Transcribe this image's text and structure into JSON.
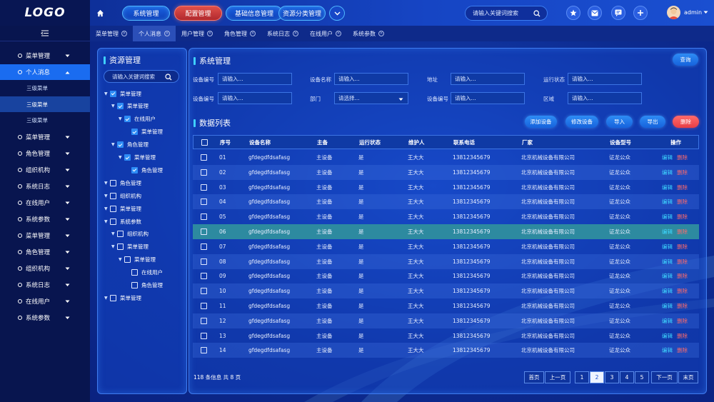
{
  "app": {
    "logo": "LOGO"
  },
  "topnav": [
    {
      "label": "系统管理",
      "active": false
    },
    {
      "label": "配置管理",
      "active": true
    },
    {
      "label": "基础信息管理",
      "active": false
    },
    {
      "label": "资源分类管理",
      "active": false
    }
  ],
  "top_search": {
    "placeholder": "请输入关键词搜索"
  },
  "user": {
    "name": "admin"
  },
  "sidebar": {
    "items": [
      {
        "label": "菜单管理",
        "active": false
      },
      {
        "label": "个人消息",
        "active": true,
        "expanded": true,
        "children": [
          {
            "label": "三级菜单",
            "active": false
          },
          {
            "label": "三级菜单",
            "active": true
          },
          {
            "label": "三级菜单",
            "active": false
          }
        ]
      },
      {
        "label": "菜单管理",
        "active": false
      },
      {
        "label": "角色管理",
        "active": false
      },
      {
        "label": "组织机构",
        "active": false
      },
      {
        "label": "系统日志",
        "active": false
      },
      {
        "label": "在线用户",
        "active": false
      },
      {
        "label": "系统参数",
        "active": false
      },
      {
        "label": "菜单管理",
        "active": false
      },
      {
        "label": "角色管理",
        "active": false
      },
      {
        "label": "组织机构",
        "active": false
      },
      {
        "label": "系统日志",
        "active": false
      },
      {
        "label": "在线用户",
        "active": false
      },
      {
        "label": "系统参数",
        "active": false
      }
    ]
  },
  "tabs": [
    {
      "label": "菜单管理",
      "active": false
    },
    {
      "label": "个人消息",
      "active": true
    },
    {
      "label": "用户管理",
      "active": false
    },
    {
      "label": "角色管理",
      "active": false
    },
    {
      "label": "系统日志",
      "active": false
    },
    {
      "label": "在线用户",
      "active": false
    },
    {
      "label": "系统参数",
      "active": false
    }
  ],
  "tree": {
    "title": "资源管理",
    "search_placeholder": "请输入关键词搜索",
    "nodes": [
      {
        "label": "菜单管理",
        "level": 0,
        "caret": true,
        "checked": true
      },
      {
        "label": "菜单管理",
        "level": 1,
        "caret": true,
        "checked": true
      },
      {
        "label": "在线用户",
        "level": 2,
        "caret": true,
        "checked": true
      },
      {
        "label": "菜单管理",
        "level": 3,
        "caret": false,
        "checked": true
      },
      {
        "label": "角色管理",
        "level": 1,
        "caret": true,
        "checked": true
      },
      {
        "label": "菜单管理",
        "level": 2,
        "caret": true,
        "checked": true
      },
      {
        "label": "角色管理",
        "level": 3,
        "caret": false,
        "checked": true
      },
      {
        "label": "角色管理",
        "level": 0,
        "caret": true,
        "checked": false
      },
      {
        "label": "组织机构",
        "level": 0,
        "caret": true,
        "checked": false
      },
      {
        "label": "菜单管理",
        "level": 0,
        "caret": true,
        "checked": false
      },
      {
        "label": "系统参数",
        "level": 0,
        "caret": true,
        "checked": false
      },
      {
        "label": "组织机构",
        "level": 1,
        "caret": true,
        "checked": false
      },
      {
        "label": "菜单管理",
        "level": 1,
        "caret": true,
        "checked": false
      },
      {
        "label": "菜单管理",
        "level": 2,
        "caret": true,
        "checked": false
      },
      {
        "label": "在线用户",
        "level": 3,
        "caret": false,
        "checked": false
      },
      {
        "label": "角色管理",
        "level": 3,
        "caret": false,
        "checked": false
      },
      {
        "label": "菜单管理",
        "level": 0,
        "caret": true,
        "checked": false
      }
    ]
  },
  "system": {
    "title": "系统管理",
    "query_label": "查询"
  },
  "filters": [
    {
      "label": "设备编号",
      "value": "请输入...",
      "select": false
    },
    {
      "label": "设备名称",
      "value": "请输入...",
      "select": false
    },
    {
      "label": "地址",
      "value": "请输入...",
      "select": false
    },
    {
      "label": "运行状态",
      "value": "请输入...",
      "select": false
    },
    {
      "label": "设备编号",
      "value": "请输入...",
      "select": false
    },
    {
      "label": "部门",
      "value": "请选择...",
      "select": true
    },
    {
      "label": "设备编号",
      "value": "请输入...",
      "select": false
    },
    {
      "label": "区域",
      "value": "请输入...",
      "select": false
    }
  ],
  "data_list": {
    "title": "数据列表",
    "actions": [
      {
        "label": "添加设备",
        "danger": false
      },
      {
        "label": "修改设备",
        "danger": false
      },
      {
        "label": "导入",
        "danger": false
      },
      {
        "label": "导出",
        "danger": false
      },
      {
        "label": "删除",
        "danger": true
      }
    ]
  },
  "table": {
    "columns": [
      "序号",
      "设备名称",
      "主备",
      "运行状态",
      "维护人",
      "联系电话",
      "厂家",
      "设备型号",
      "操作"
    ],
    "edit_label": "编辑",
    "delete_label": "删除",
    "selected_row": 5,
    "rows": [
      [
        "01",
        "gfdegdfdsafasg",
        "主设备",
        "是",
        "王大大",
        "13812345679",
        "北京机械设备有限公司",
        "证龙公众"
      ],
      [
        "02",
        "gfdegdfdsafasg",
        "主设备",
        "是",
        "王大大",
        "13812345679",
        "北京机械设备有限公司",
        "证龙公众"
      ],
      [
        "03",
        "gfdegdfdsafasg",
        "主设备",
        "是",
        "王大大",
        "13812345679",
        "北京机械设备有限公司",
        "证龙公众"
      ],
      [
        "04",
        "gfdegdfdsafasg",
        "主设备",
        "是",
        "王大大",
        "13812345679",
        "北京机械设备有限公司",
        "证龙公众"
      ],
      [
        "05",
        "gfdegdfdsafasg",
        "主设备",
        "是",
        "王大大",
        "13812345679",
        "北京机械设备有限公司",
        "证龙公众"
      ],
      [
        "06",
        "gfdegdfdsafasg",
        "主设备",
        "是",
        "王大大",
        "13812345679",
        "北京机械设备有限公司",
        "证龙公众"
      ],
      [
        "07",
        "gfdegdfdsafasg",
        "主设备",
        "是",
        "王大大",
        "13812345679",
        "北京机械设备有限公司",
        "证龙公众"
      ],
      [
        "08",
        "gfdegdfdsafasg",
        "主设备",
        "是",
        "王大大",
        "13812345679",
        "北京机械设备有限公司",
        "证龙公众"
      ],
      [
        "09",
        "gfdegdfdsafasg",
        "主设备",
        "是",
        "王大大",
        "13812345679",
        "北京机械设备有限公司",
        "证龙公众"
      ],
      [
        "10",
        "gfdegdfdsafasg",
        "主设备",
        "是",
        "王大大",
        "13812345679",
        "北京机械设备有限公司",
        "证龙公众"
      ],
      [
        "11",
        "gfdegdfdsafasg",
        "主设备",
        "是",
        "王大大",
        "13812345679",
        "北京机械设备有限公司",
        "证龙公众"
      ],
      [
        "12",
        "gfdegdfdsafasg",
        "主设备",
        "是",
        "王大大",
        "13812345679",
        "北京机械设备有限公司",
        "证龙公众"
      ],
      [
        "13",
        "gfdegdfdsafasg",
        "主设备",
        "是",
        "王大大",
        "13812345679",
        "北京机械设备有限公司",
        "证龙公众"
      ],
      [
        "14",
        "gfdegdfdsafasg",
        "主设备",
        "是",
        "王大大",
        "13812345679",
        "北京机械设备有限公司",
        "证龙公众"
      ]
    ]
  },
  "pagination": {
    "info": "118 条信息 共 8 页",
    "first": "首页",
    "prev": "上一页",
    "next": "下一页",
    "last": "末页",
    "pages": [
      "1",
      "2",
      "3",
      "4",
      "5"
    ],
    "current": "2"
  },
  "colors": {
    "accent": "#1a6cf0",
    "danger": "#e83e45",
    "edit": "#3fd8ff",
    "selected_row": "#2d8aa0"
  }
}
